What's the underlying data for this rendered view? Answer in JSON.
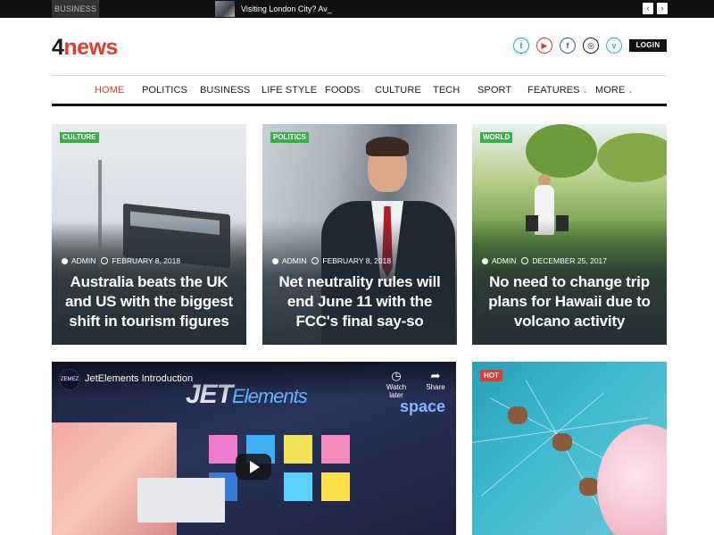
{
  "topbar": {
    "category": "BUSINESS",
    "ticker": "Visiting London City? Av_",
    "prev_label": "‹",
    "next_label": "›"
  },
  "header": {
    "logo_num": "4",
    "logo_word": "news",
    "login_label": "LOGIN",
    "social": [
      {
        "name": "twitter-icon",
        "glyph": "t"
      },
      {
        "name": "youtube-icon",
        "glyph": "▶"
      },
      {
        "name": "facebook-icon",
        "glyph": "f"
      },
      {
        "name": "instagram-icon",
        "glyph": "◎"
      },
      {
        "name": "vimeo-icon",
        "glyph": "v"
      }
    ]
  },
  "nav": {
    "items": [
      "HOME",
      "POLITICS",
      "BUSINESS",
      "LIFE STYLE",
      "FOODS",
      "CULTURE",
      "TECH",
      "SPORT",
      "FEATURES",
      "MORE"
    ],
    "active": "HOME",
    "caret": "⌄"
  },
  "cards": [
    {
      "tag": "CULTURE",
      "author": "ADMIN",
      "date": "FEBRUARY 8, 2018",
      "title": "Australia beats the UK and US with the biggest shift in tourism figures"
    },
    {
      "tag": "POLITICS",
      "author": "ADMIN",
      "date": "FEBRUARY 8, 2018",
      "title": "Net neutrality rules will end June 11 with the FCC's final say-so"
    },
    {
      "tag": "WORLD",
      "author": "ADMIN",
      "date": "DECEMBER 25, 2017",
      "title": "No need to change trip plans for Hawaii due to volcano activity"
    }
  ],
  "video": {
    "title": "JetElements Introduction",
    "channel_badge": "ZEMEZ",
    "watch_later": "Watch later",
    "share": "Share",
    "brand_bold": "JET",
    "brand_thin": "Elements",
    "bg_word": "space"
  },
  "hot": {
    "tag": "HOT"
  },
  "colors": {
    "accent": "#e03c31",
    "tag_green": "#3cae4a",
    "dark": "#111111"
  }
}
